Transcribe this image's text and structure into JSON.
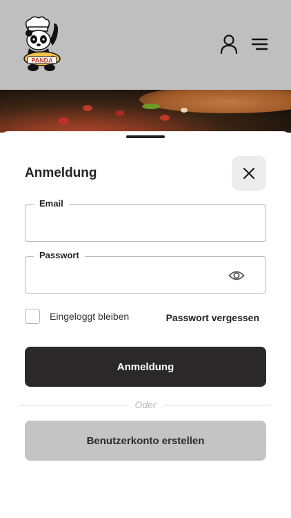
{
  "header": {
    "logo_text": "PANDA",
    "user_icon": "user-icon",
    "menu_icon": "hamburger-menu-icon"
  },
  "login_sheet": {
    "title": "Anmeldung",
    "close_icon": "close-icon",
    "email": {
      "label": "Email",
      "value": "",
      "placeholder": ""
    },
    "password": {
      "label": "Passwort",
      "value": "",
      "placeholder": "",
      "toggle_icon": "eye-icon"
    },
    "remember_me": {
      "label": "Eingeloggt bleiben",
      "checked": false
    },
    "forgot_password": "Passwort vergessen",
    "login_button": "Anmeldung",
    "divider_text": "Oder",
    "register_button": "Benutzerkonto erstellen"
  },
  "colors": {
    "primary_button": "#2a2828",
    "secondary_button": "#c4c4c4",
    "overlay": "#bfbfbf"
  }
}
